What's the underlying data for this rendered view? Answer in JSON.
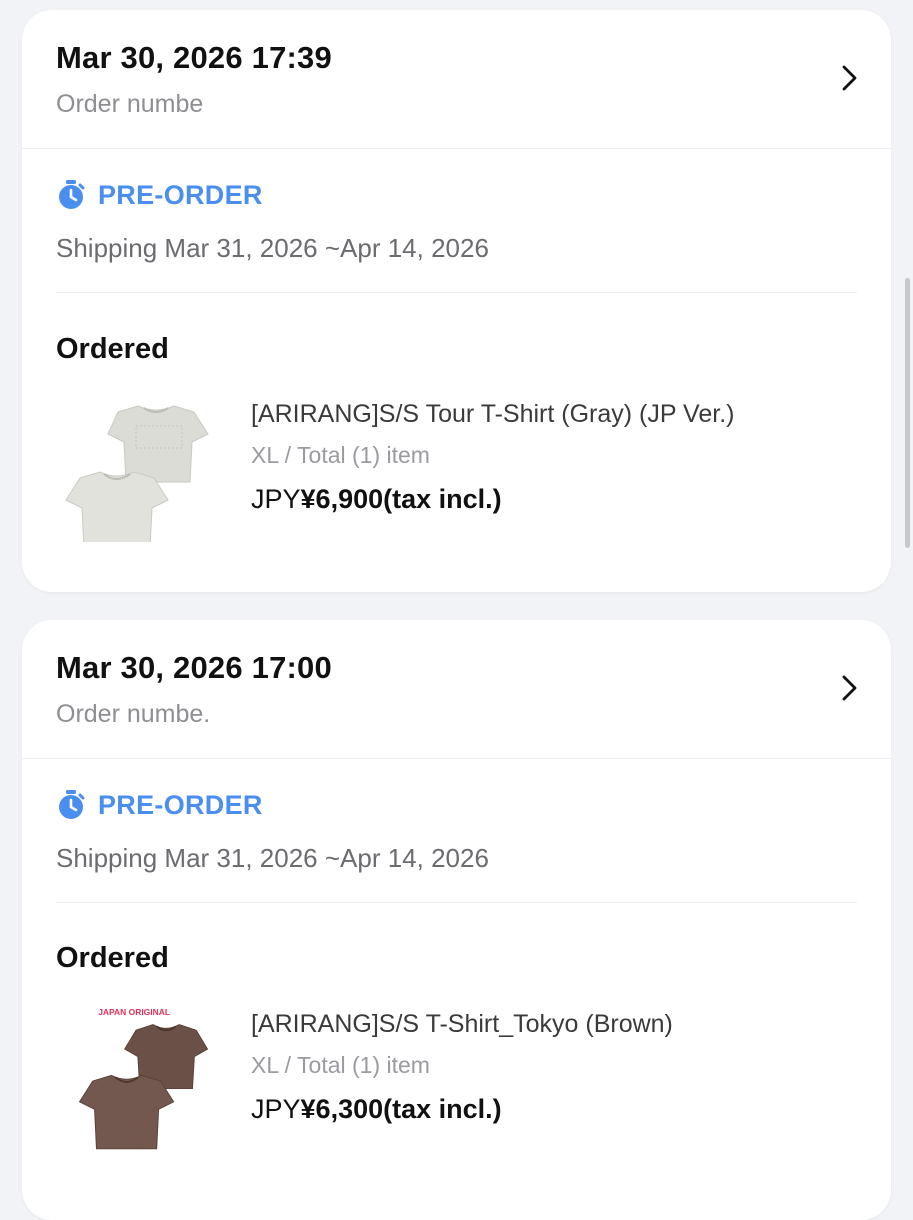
{
  "orders": [
    {
      "date": "Mar 30, 2026 17:39",
      "order_number_label": "Order numbe",
      "status": "PRE-ORDER",
      "shipping": "Shipping Mar 31, 2026 ~Apr 14, 2026",
      "section_title": "Ordered",
      "product": {
        "name": "[ARIRANG]S/S Tour T-Shirt (Gray) (JP Ver.)",
        "variant": "XL / Total (1) item",
        "currency": "JPY",
        "price": "¥6,900(tax incl.)",
        "thumbnail_icon": "gray-tshirt-image",
        "thumbnail_color": "#dcdcd6"
      }
    },
    {
      "date": "Mar 30, 2026 17:00",
      "order_number_label": "Order numbe.",
      "status": "PRE-ORDER",
      "shipping": "Shipping Mar 31, 2026 ~Apr 14, 2026",
      "section_title": "Ordered",
      "product": {
        "name": "[ARIRANG]S/S T-Shirt_Tokyo (Brown)",
        "variant": "XL / Total (1) item",
        "currency": "JPY",
        "price": "¥6,300(tax incl.)",
        "thumbnail_icon": "brown-tshirt-image",
        "thumbnail_text": "JAPAN ORIGINAL",
        "thumbnail_color": "#6b5047"
      }
    }
  ],
  "colors": {
    "accent": "#4a8ff0",
    "background": "#f2f3f6",
    "card": "#ffffff"
  }
}
